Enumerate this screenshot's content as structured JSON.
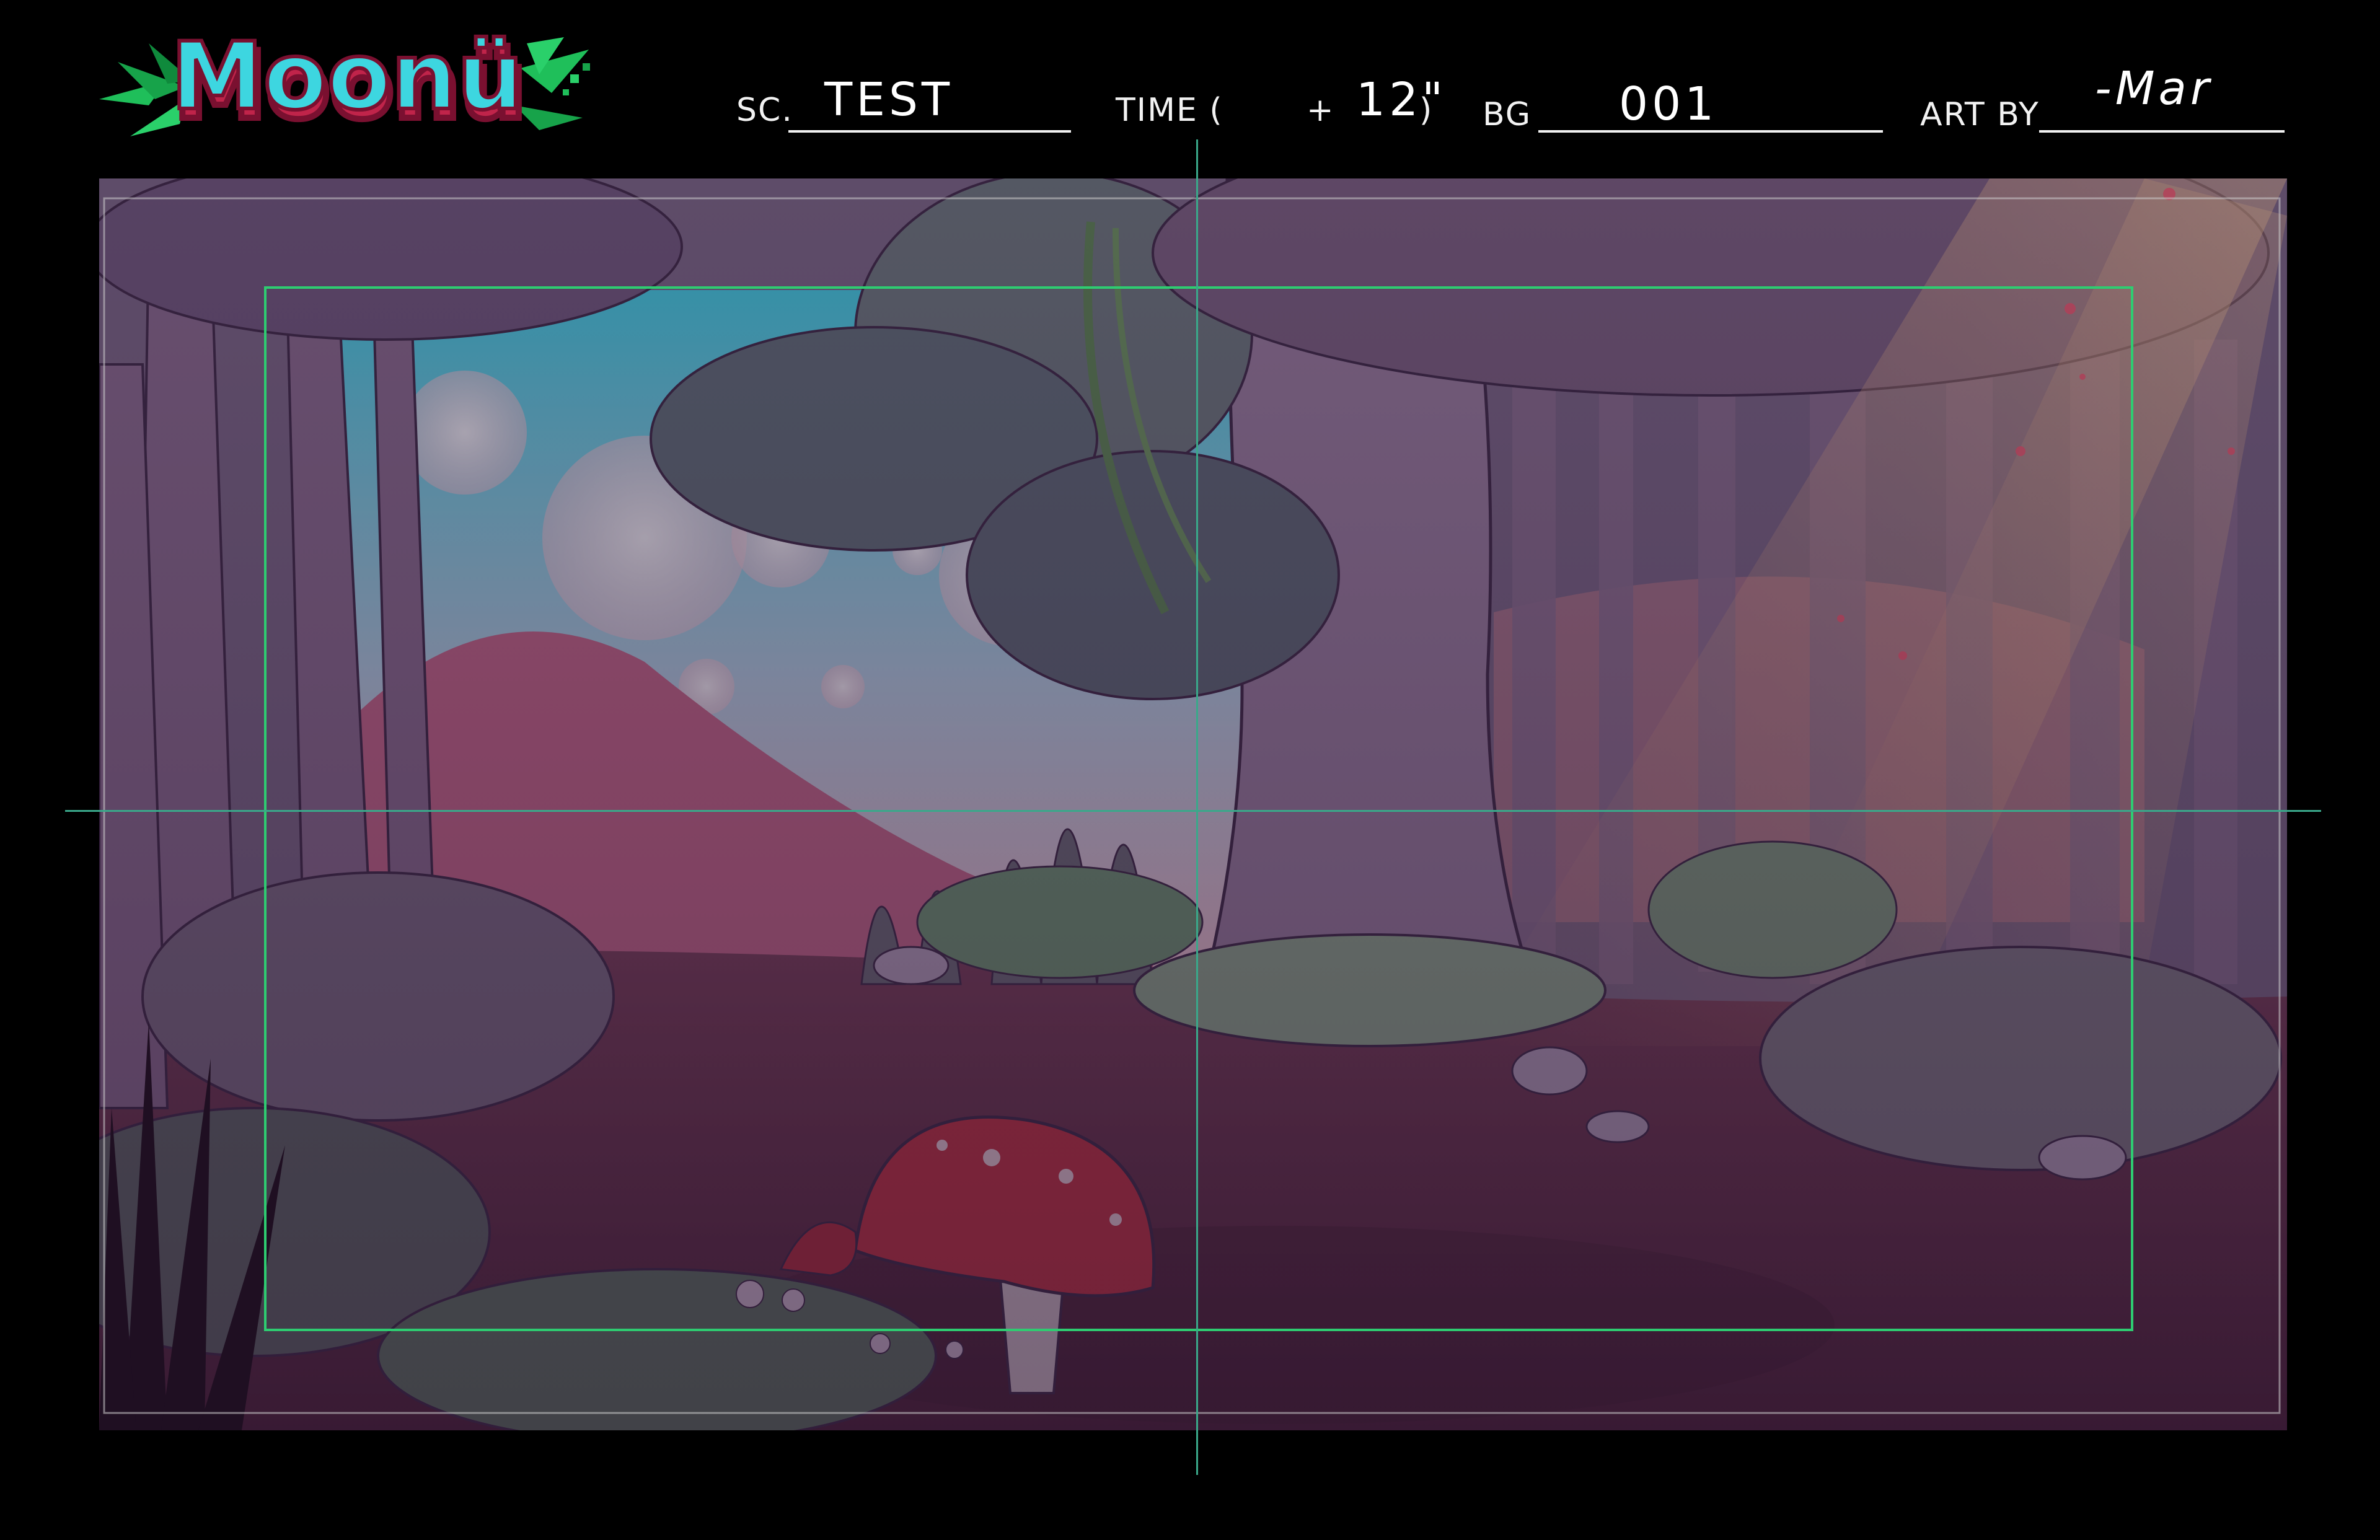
{
  "logo": {
    "text": "Moonü",
    "colors": {
      "fill": "#3dd6e0",
      "outline": "#c0244a",
      "leaves": "#1fbf5a"
    }
  },
  "slate": {
    "scene_label": "SC.",
    "scene_value": "TEST",
    "time_label": "TIME (",
    "time_plus": "+",
    "time_value": "12\"",
    "time_close": ")",
    "bg_label": "BG",
    "bg_value": "001",
    "art_label": "ART BY",
    "art_value": "-Mar"
  },
  "guides": {
    "safe_frame_color": "#2ecc71",
    "center_cross_color": "#3aa88a",
    "outer_frame_color": "#cfcfcf"
  },
  "colors": {
    "sky_top": "#3ed8ea",
    "sky_bottom": "#f7c6d0",
    "hill": "#c96a8a",
    "ground": "#6e3b52",
    "foliage": "#7a9a78",
    "trunk": "#8c7491",
    "mushroom_cap": "#c8333f",
    "light_rays": "#f6b27a"
  }
}
